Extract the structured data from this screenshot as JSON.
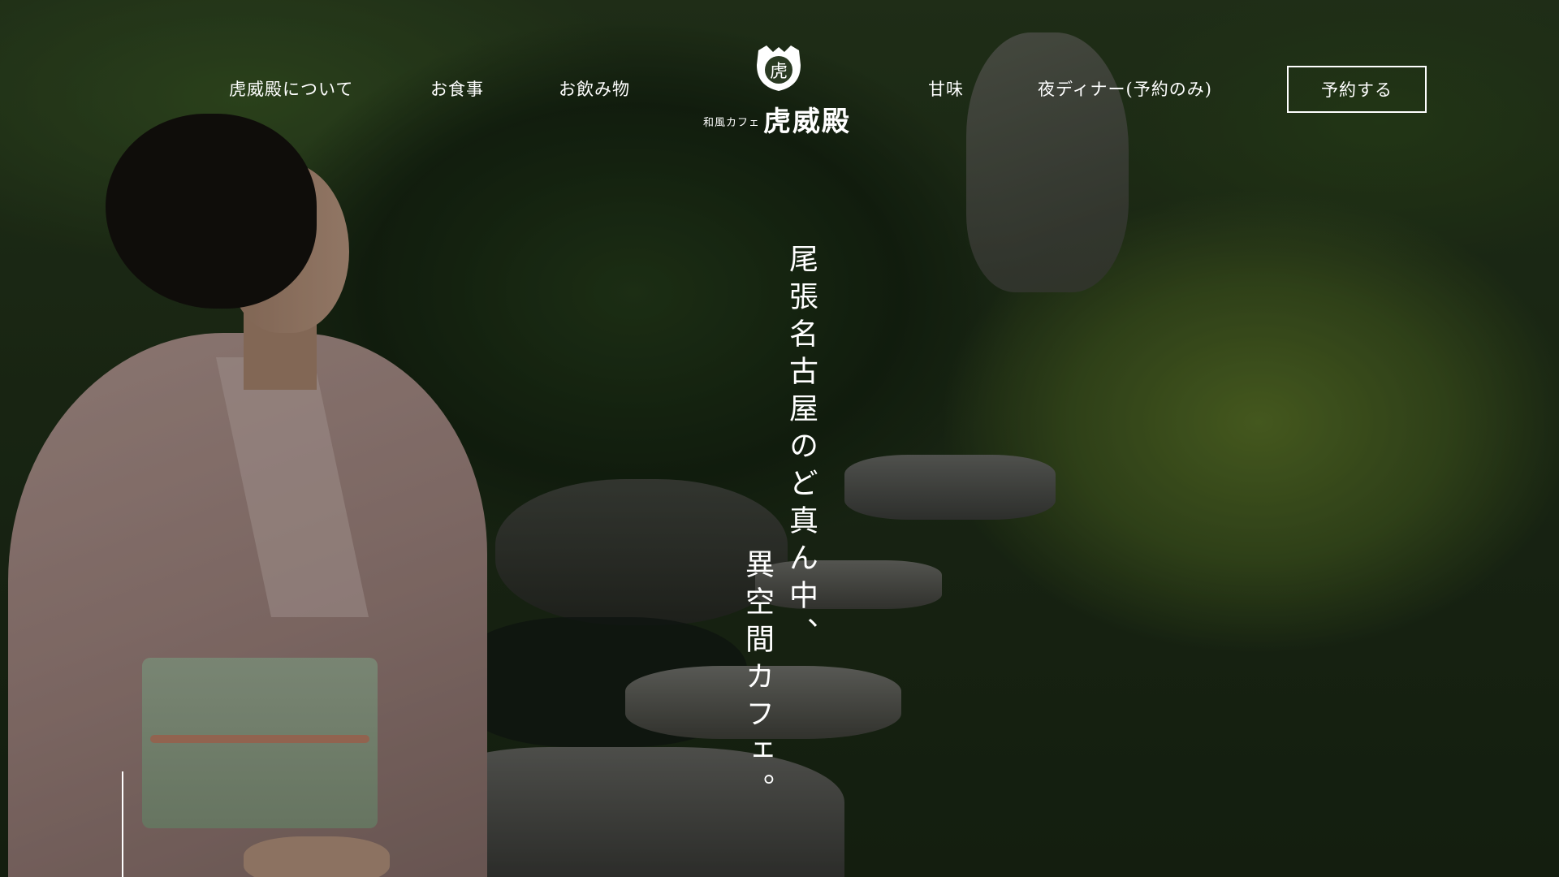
{
  "nav": {
    "about": "虎威殿について",
    "food": "お食事",
    "drinks": "お飲み物",
    "sweets": "甘味",
    "dinner": "夜ディナー(予約のみ)",
    "reserve": "予約する"
  },
  "logo": {
    "mark_char": "虎",
    "subtitle": "和風カフェ",
    "name": "虎威殿"
  },
  "hero": {
    "tagline_line1": "尾張名古屋のど真ん中、",
    "tagline_line2": "異空間カフェ。"
  },
  "icons": {
    "logo_mark": "tiger-crest-icon"
  },
  "colors": {
    "text": "#ffffff"
  }
}
